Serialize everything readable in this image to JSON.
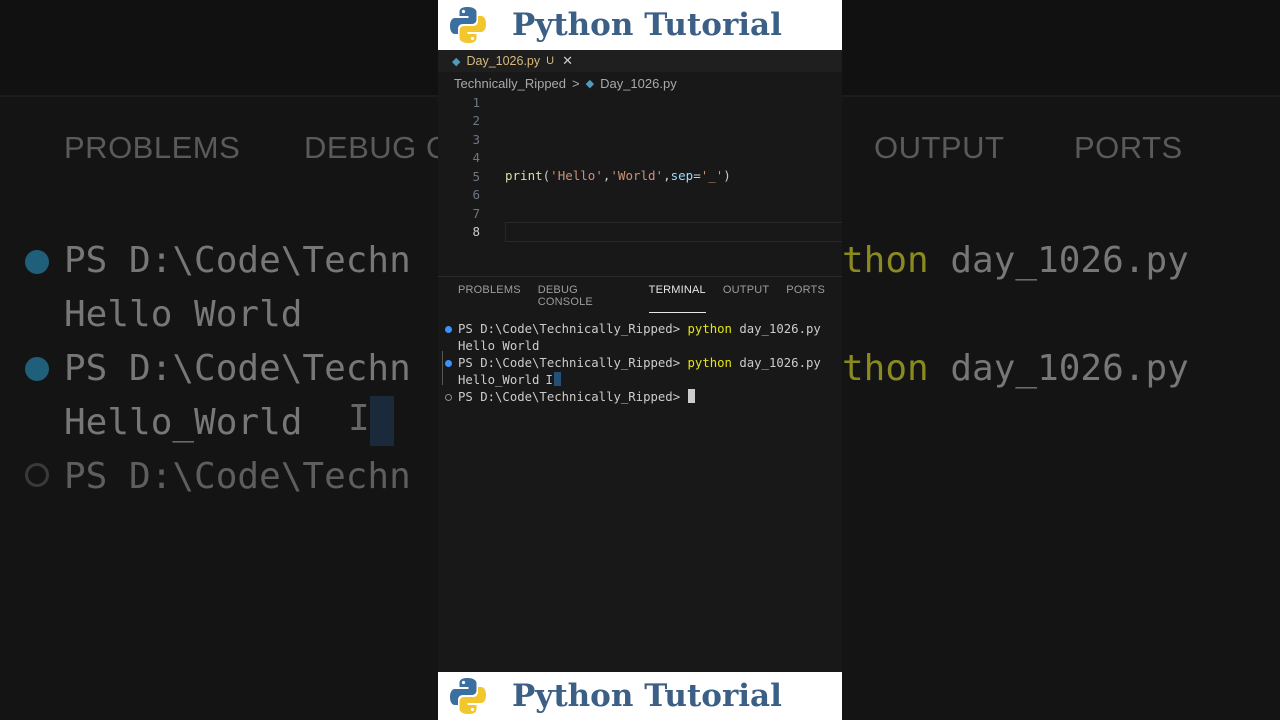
{
  "banner": {
    "title": "Python Tutorial"
  },
  "editor_tab": {
    "filename": "Day_1026.py",
    "status": "U",
    "close": "✕"
  },
  "breadcrumb": {
    "folder": "Technically_Ripped",
    "separator": ">",
    "file": "Day_1026.py"
  },
  "editor": {
    "line_numbers": [
      "1",
      "2",
      "3",
      "4",
      "5",
      "6",
      "7",
      "8"
    ],
    "active_line": "8",
    "code": {
      "fn": "print",
      "open": "(",
      "s1": "'Hello'",
      "comma1": ",",
      "s2": "'World'",
      "comma2": ",",
      "kw": "sep",
      "eq": "=",
      "s3": "'_'",
      "close": ")"
    }
  },
  "panel": {
    "tabs": [
      "PROBLEMS",
      "DEBUG CONSOLE",
      "TERMINAL",
      "OUTPUT",
      "PORTS"
    ],
    "active_tab": "TERMINAL"
  },
  "terminal": {
    "prompt": "PS D:\\Code\\Technically_Ripped> ",
    "command": "python",
    "arg": " day_1026.py",
    "output1": "Hello World",
    "output2": "Hello_World",
    "ibeam": "I"
  },
  "background": {
    "tabs": [
      "PROBLEMS",
      "DEBUG C",
      "OUTPUT",
      "PORTS"
    ],
    "lines": [
      "PS D:\\Code\\Techn",
      "Hello World",
      "PS D:\\Code\\Techn",
      "Hello_World",
      "PS D:\\Code\\Techn"
    ],
    "right_cmd": "thon",
    "right_arg": " day_1026.py",
    "ibeam": "I"
  },
  "colors": {
    "banner_title": "#3b5f85",
    "accent_blue": "#3794ff",
    "command_yellow": "#e5e510"
  }
}
